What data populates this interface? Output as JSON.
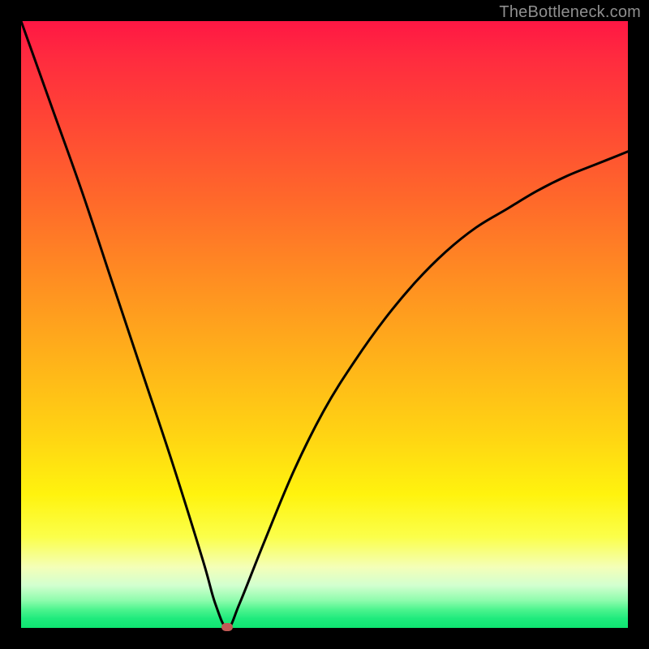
{
  "watermark": "TheBottleneck.com",
  "colors": {
    "frame": "#000000",
    "curve": "#000000",
    "dot": "#c15a56"
  },
  "chart_data": {
    "type": "line",
    "title": "",
    "xlabel": "",
    "ylabel": "",
    "xlim": [
      0,
      100
    ],
    "ylim": [
      0,
      100
    ],
    "grid": false,
    "legend": false,
    "annotations": [
      {
        "text": "TheBottleneck.com",
        "position": "top-right"
      }
    ],
    "marker": {
      "x": 34,
      "y": 0,
      "color": "#c15a56"
    },
    "series": [
      {
        "name": "bottleneck-curve",
        "x": [
          0,
          5,
          10,
          15,
          20,
          25,
          30,
          32,
          34,
          36,
          40,
          45,
          50,
          55,
          60,
          65,
          70,
          75,
          80,
          85,
          90,
          95,
          100
        ],
        "y": [
          100,
          86,
          72,
          57,
          42,
          27,
          11,
          4,
          0,
          4,
          14,
          26,
          36,
          44,
          51,
          57,
          62,
          66,
          69,
          72,
          74.5,
          76.5,
          78.5
        ]
      }
    ]
  }
}
